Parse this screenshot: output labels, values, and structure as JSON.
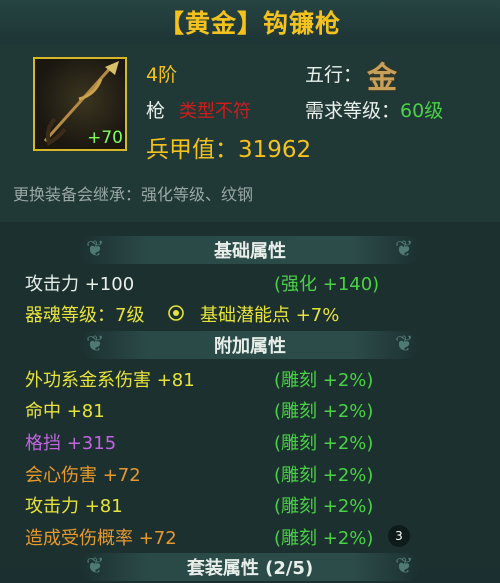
{
  "header": {
    "title": "【黄金】钩镰枪"
  },
  "item": {
    "enhance_badge": "+70",
    "grade": "4阶",
    "weapon_type": "枪",
    "type_warning": "类型不符",
    "armor_value": "兵甲值：31962",
    "element_label": "五行：",
    "element_glyph": "金",
    "required_label": "需求等级：",
    "required_value": "60级"
  },
  "inherit_note": "更换装备会继承：强化等级、纹钢",
  "sections": {
    "base_title": "基础属性",
    "extra_title": "附加属性",
    "set_title": "套装属性 (2/5)"
  },
  "base_stats": [
    {
      "name": "攻击力 +100",
      "extra": "(强化 +140)"
    },
    {
      "name": "器魂等级：7级",
      "extra": "基础潜能点  +7%"
    }
  ],
  "extra_stats": [
    {
      "name": "外功系金系伤害  +81",
      "extra": "(雕刻 +2%)"
    },
    {
      "name": "命中  +81",
      "extra": "(雕刻 +2%)"
    },
    {
      "name": "格挡  +315",
      "extra": "(雕刻 +2%)"
    },
    {
      "name": "会心伤害  +72",
      "extra": "(雕刻 +2%)"
    },
    {
      "name": "攻击力  +81",
      "extra": "(雕刻 +2%)"
    },
    {
      "name": "造成受伤概率  +72",
      "extra": "(雕刻 +2%)"
    }
  ],
  "badge_count": "3",
  "colors": {
    "title": "#f3c21f",
    "green": "#49d244",
    "yellow": "#e7e33a",
    "purple": "#c064e0",
    "orange": "#e79a2b",
    "warning": "#d11c1c"
  }
}
